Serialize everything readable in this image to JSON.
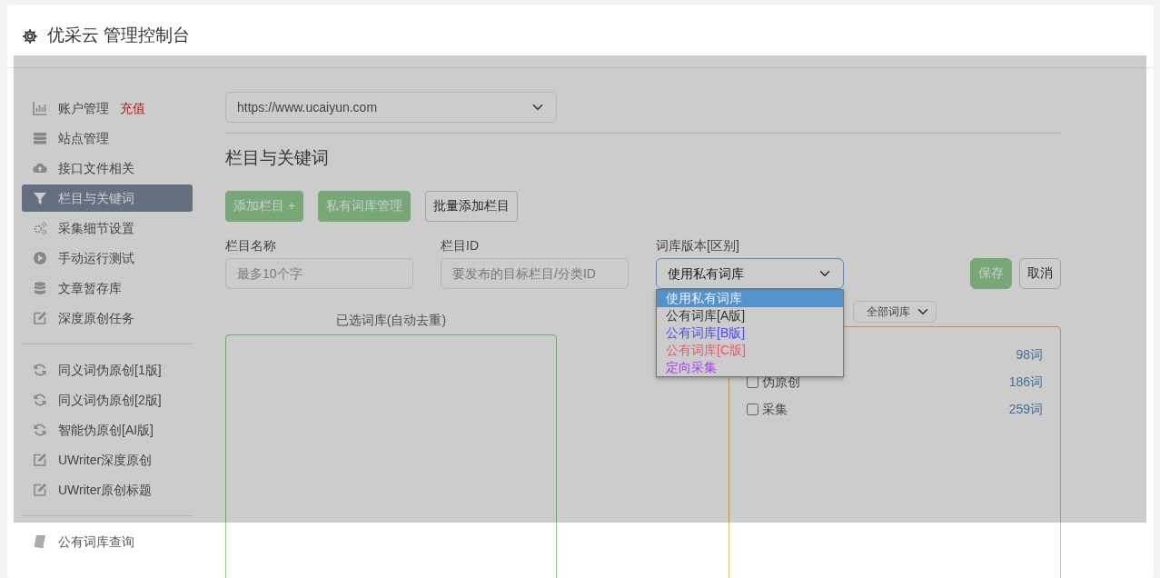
{
  "header": {
    "title": "优采云 管理控制台"
  },
  "sidebar": {
    "groups": [
      {
        "items": [
          {
            "label": "账户管理",
            "badge": "充值",
            "selected": false
          },
          {
            "label": "站点管理",
            "selected": false
          },
          {
            "label": "接口文件相关",
            "selected": false
          },
          {
            "label": "栏目与关键词",
            "selected": true
          },
          {
            "label": "采集细节设置",
            "selected": false
          },
          {
            "label": "手动运行测试",
            "selected": false
          },
          {
            "label": "文章暂存库",
            "selected": false
          },
          {
            "label": "深度原创任务",
            "selected": false
          }
        ]
      },
      {
        "items": [
          {
            "label": "同义词伪原创[1版]",
            "selected": false
          },
          {
            "label": "同义词伪原创[2版]",
            "selected": false
          },
          {
            "label": "智能伪原创[AI版]",
            "selected": false
          },
          {
            "label": "UWriter深度原创",
            "selected": false
          },
          {
            "label": "UWriter原创标题",
            "selected": false
          }
        ]
      },
      {
        "items": [
          {
            "label": "公有词库查询",
            "selected": false
          }
        ]
      }
    ]
  },
  "site_select": {
    "value": "https://www.ucaiyun.com"
  },
  "section_title": "栏目与关键词",
  "toolbar_buttons": [
    {
      "label": "添加栏目 +",
      "kind": "success"
    },
    {
      "label": "私有词库管理",
      "kind": "success"
    },
    {
      "label": "批量添加栏目",
      "kind": "default"
    }
  ],
  "form": {
    "fields": [
      {
        "label": "栏目名称",
        "kind": "input",
        "placeholder": "最多10个字"
      },
      {
        "label": "栏目ID",
        "kind": "input",
        "placeholder": "要发布的目标栏目/分类ID"
      },
      {
        "label": "词库版本[区别]",
        "kind": "select",
        "value": "使用私有词库",
        "expanded": true,
        "options": [
          {
            "label": "使用私有词库",
            "selected": true
          },
          {
            "label": "公有词库[A版]",
            "color": "#333333",
            "selected": false
          },
          {
            "label": "公有词库[B版]",
            "color": "#4b4bff",
            "selected": false
          },
          {
            "label": "公有词库[C版]",
            "color": "#e8586f",
            "selected": false
          },
          {
            "label": "定向采集",
            "color": "#a43cf0",
            "selected": false
          }
        ]
      }
    ],
    "buttons": [
      {
        "label": "保存",
        "kind": "success"
      },
      {
        "label": "取消",
        "kind": "default"
      }
    ]
  },
  "selected_panel": {
    "title": "已选词库(自动去重)"
  },
  "library_panel": {
    "filter": "全部词库",
    "rows": [
      {
        "count": "98词"
      },
      {
        "label": "伪原创",
        "checked": false,
        "count": "186词"
      },
      {
        "label": "采集",
        "checked": false,
        "count": "259词"
      }
    ]
  }
}
